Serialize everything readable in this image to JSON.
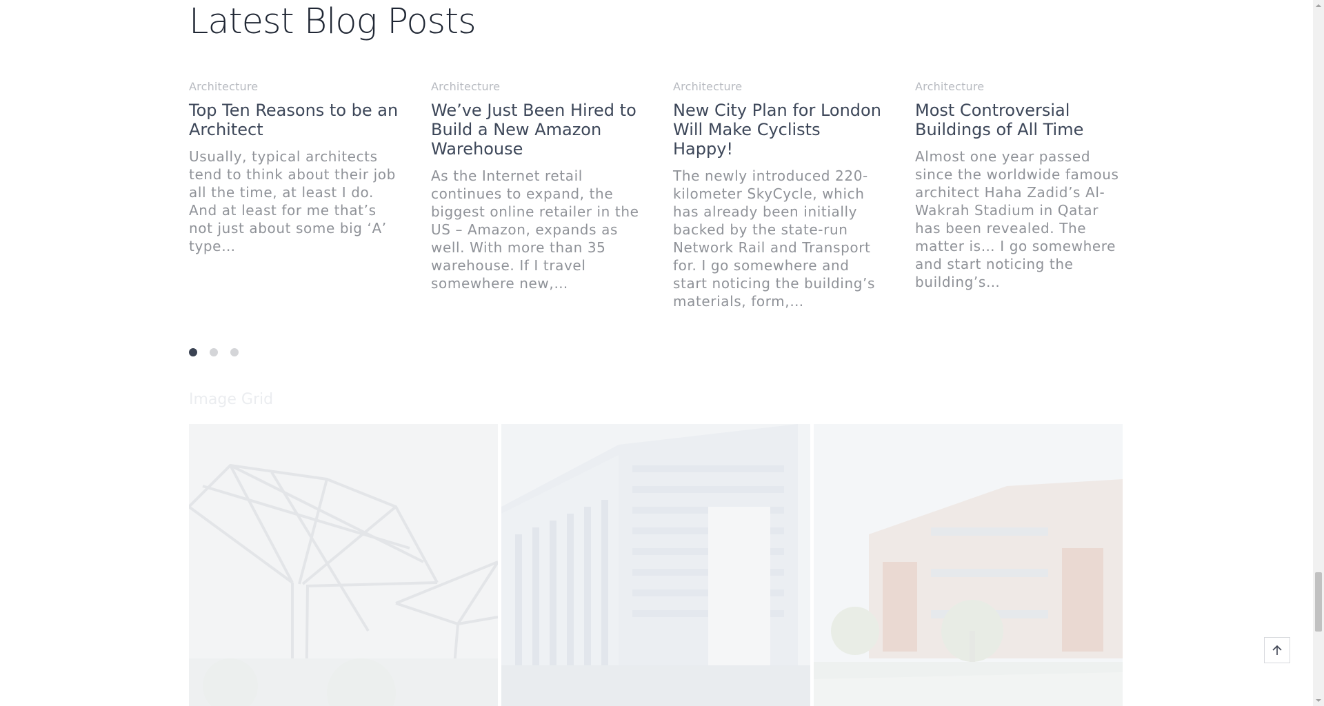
{
  "section": {
    "title": "Latest Blog Posts"
  },
  "posts": [
    {
      "category": "Architecture",
      "title": "Top Ten Reasons to be an Architect",
      "excerpt": "Usually, typical architects tend to think about their job all the time, at least I do. And at least for me that’s not just about some big ‘A’ type…"
    },
    {
      "category": "Architecture",
      "title": "We’ve Just Been Hired to Build a New Amazon Warehouse",
      "excerpt": "As the Internet retail continues to expand, the biggest online retailer in the US – Amazon, expands as well. With more than 35 warehouse. If I travel somewhere new,…"
    },
    {
      "category": "Architecture",
      "title": "New City Plan for London Will Make Cyclists Happy!",
      "excerpt": "The newly introduced 220-kilometer SkyCycle, which has already been initially backed by the state-run Network Rail and Transport for. I go somewhere and start noticing the building’s materials, form,…"
    },
    {
      "category": "Architecture",
      "title": "Most Controversial Buildings of All Time",
      "excerpt": "Almost one year passed since the worldwide famous architect Haha Zadid’s Al-Wakrah Stadium in Qatar has been revealed. The matter is… I go somewhere and start noticing the building’s…"
    }
  ],
  "carousel": {
    "page_count": 3,
    "active_index": 0
  },
  "image_grid": {
    "label": "Image Grid"
  },
  "colors": {
    "accent": "#3a4252",
    "muted_text": "#8f9298",
    "category_text": "#b7bac0"
  },
  "icons": {
    "scroll_top": "arrow-up-icon"
  }
}
